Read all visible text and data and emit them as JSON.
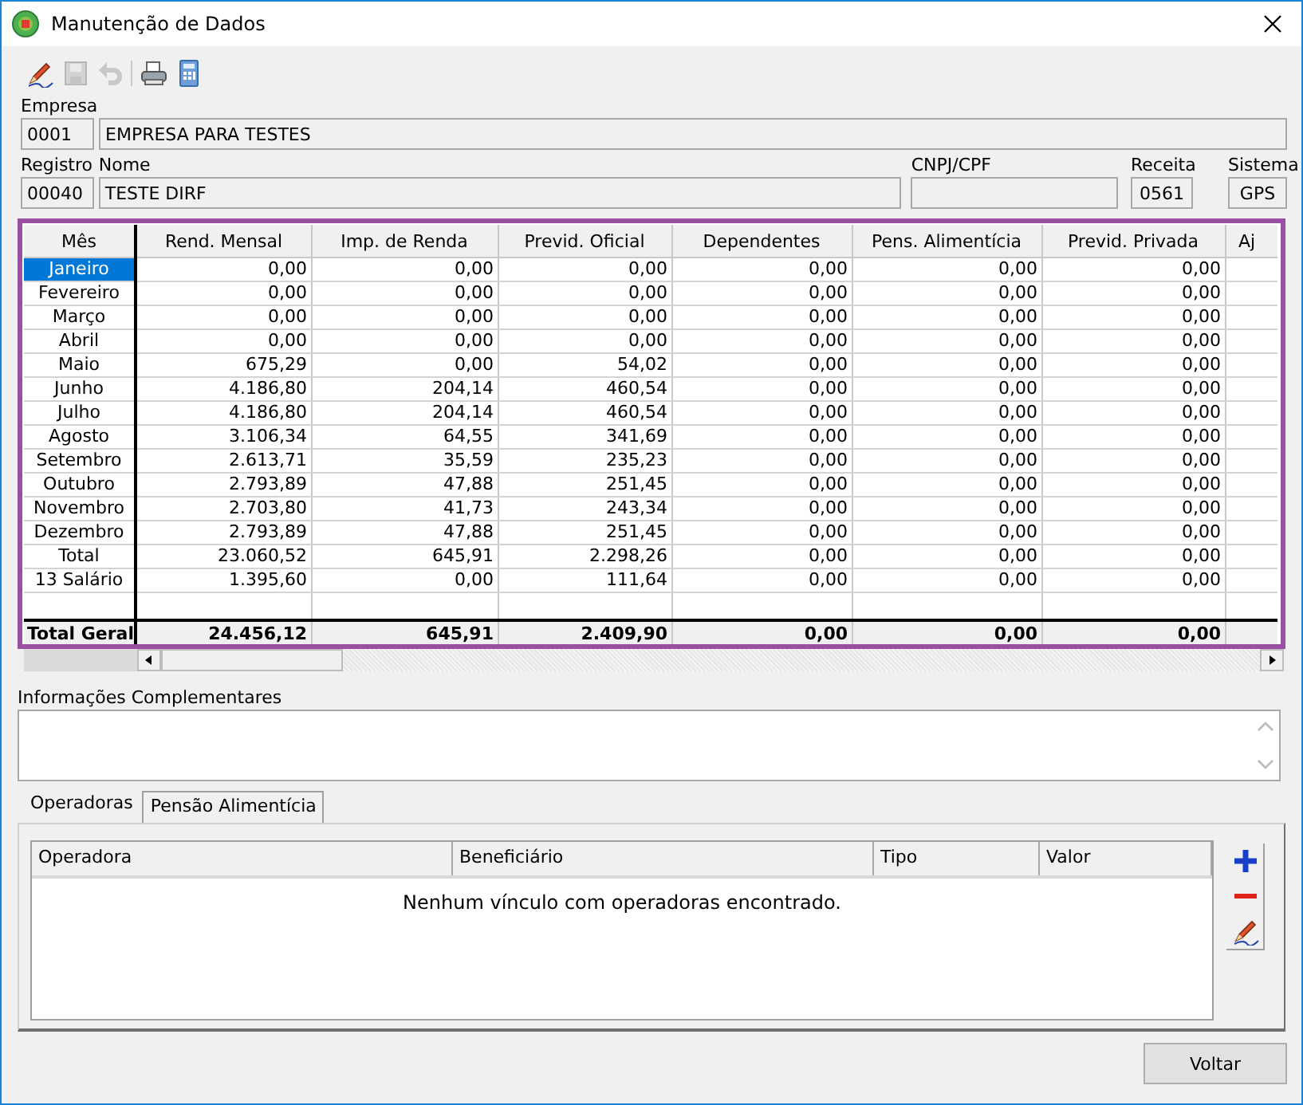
{
  "window": {
    "title": "Manutenção de Dados"
  },
  "toolbar": [
    {
      "kind": "edit",
      "disabled": false
    },
    {
      "kind": "save",
      "disabled": true
    },
    {
      "kind": "undo",
      "disabled": true
    },
    {
      "kind": "separator"
    },
    {
      "kind": "print",
      "disabled": false
    },
    {
      "kind": "calculator",
      "disabled": false
    }
  ],
  "field_rows": [
    {
      "fields": [
        {
          "kind": "code",
          "label": "Empresa",
          "value": "0001"
        },
        {
          "kind": "wide",
          "value": "EMPRESA PARA TESTES"
        }
      ]
    },
    {
      "fields": [
        {
          "kind": "code",
          "label": "Registro",
          "value": "00040"
        },
        {
          "kind": "name",
          "label": "Nome",
          "value": "TESTE DIRF"
        },
        {
          "kind": "cnpj",
          "label": "CNPJ/CPF"
        },
        {
          "kind": "receita",
          "label": "Receita",
          "value": "0561"
        },
        {
          "kind": "sistema",
          "label": "Sistema",
          "value": "GPS"
        }
      ]
    }
  ],
  "grid": {
    "columns": [
      "Mês",
      "Rend. Mensal",
      "Imp. de Renda",
      "Previd. Oficial",
      "Dependentes",
      "Pens. Alimentícia",
      "Previd. Privada",
      "Aj"
    ],
    "rows": [
      {
        "month": "Janeiro",
        "selected": true,
        "values": [
          "0,00",
          "0,00",
          "0,00",
          "0,00",
          "0,00",
          "0,00"
        ]
      },
      {
        "month": "Fevereiro",
        "selected": false,
        "values": [
          "0,00",
          "0,00",
          "0,00",
          "0,00",
          "0,00",
          "0,00"
        ]
      },
      {
        "month": "Março",
        "selected": false,
        "values": [
          "0,00",
          "0,00",
          "0,00",
          "0,00",
          "0,00",
          "0,00"
        ]
      },
      {
        "month": "Abril",
        "selected": false,
        "values": [
          "0,00",
          "0,00",
          "0,00",
          "0,00",
          "0,00",
          "0,00"
        ]
      },
      {
        "month": "Maio",
        "selected": false,
        "values": [
          "675,29",
          "0,00",
          "54,02",
          "0,00",
          "0,00",
          "0,00"
        ]
      },
      {
        "month": "Junho",
        "selected": false,
        "values": [
          "4.186,80",
          "204,14",
          "460,54",
          "0,00",
          "0,00",
          "0,00"
        ]
      },
      {
        "month": "Julho",
        "selected": false,
        "values": [
          "4.186,80",
          "204,14",
          "460,54",
          "0,00",
          "0,00",
          "0,00"
        ]
      },
      {
        "month": "Agosto",
        "selected": false,
        "values": [
          "3.106,34",
          "64,55",
          "341,69",
          "0,00",
          "0,00",
          "0,00"
        ]
      },
      {
        "month": "Setembro",
        "selected": false,
        "values": [
          "2.613,71",
          "35,59",
          "235,23",
          "0,00",
          "0,00",
          "0,00"
        ]
      },
      {
        "month": "Outubro",
        "selected": false,
        "values": [
          "2.793,89",
          "47,88",
          "251,45",
          "0,00",
          "0,00",
          "0,00"
        ]
      },
      {
        "month": "Novembro",
        "selected": false,
        "values": [
          "2.703,80",
          "41,73",
          "243,34",
          "0,00",
          "0,00",
          "0,00"
        ]
      },
      {
        "month": "Dezembro",
        "selected": false,
        "values": [
          "2.793,89",
          "47,88",
          "251,45",
          "0,00",
          "0,00",
          "0,00"
        ]
      },
      {
        "month": "Total",
        "selected": false,
        "values": [
          "23.060,52",
          "645,91",
          "2.298,26",
          "0,00",
          "0,00",
          "0,00"
        ]
      },
      {
        "month": "13 Salário",
        "selected": false,
        "values": [
          "1.395,60",
          "0,00",
          "111,64",
          "0,00",
          "0,00",
          "0,00"
        ]
      }
    ],
    "total": {
      "label": "Total Geral",
      "values": [
        "24.456,12",
        "645,91",
        "2.409,90",
        "0,00",
        "0,00",
        "0,00"
      ]
    }
  },
  "info": {
    "label": "Informações Complementares"
  },
  "tabs": [
    {
      "label": "Operadoras",
      "selected": true
    },
    {
      "label": "Pensão Alimentícia",
      "selected": false
    }
  ],
  "operators": {
    "columns": [
      "Operadora",
      "Beneficiário",
      "Tipo",
      "Valor"
    ],
    "empty_message": "Nenhum vínculo com operadoras encontrado.",
    "actions": [
      {
        "kind": "add"
      },
      {
        "kind": "remove"
      },
      {
        "kind": "edit"
      }
    ]
  },
  "buttons": [
    {
      "label": "Voltar"
    }
  ]
}
